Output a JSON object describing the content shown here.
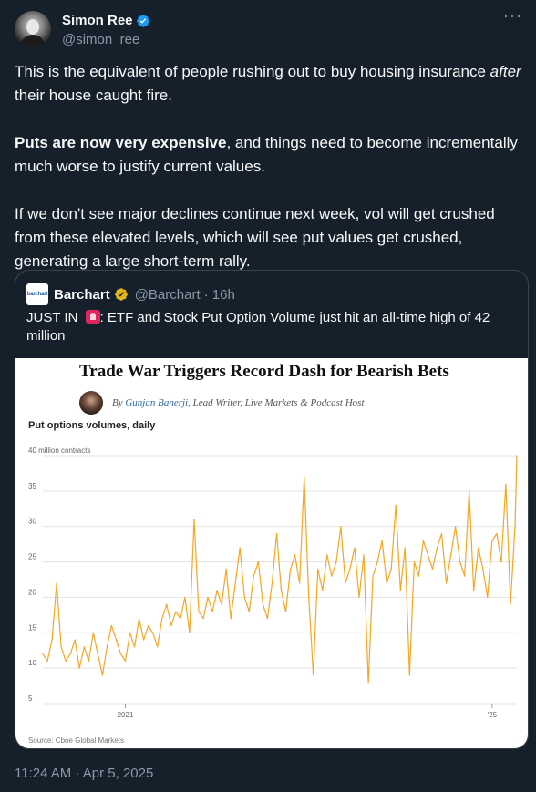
{
  "author": {
    "display_name": "Simon Ree",
    "handle": "@simon_ree",
    "verified": true
  },
  "tweet": {
    "p1_before": "This is the equivalent of people rushing out to buy housing insurance ",
    "p1_italic": "after",
    "p1_after": " their house caught fire.",
    "p2_bold": "Puts are now very expensive",
    "p2_rest": ", and things need to become incrementally much worse to justify current values.",
    "p3": "If we don't see major declines continue next week, vol will get crushed from these elevated levels, which will see put values get crushed, generating a large short-term rally."
  },
  "quote": {
    "logo_text": "barchart",
    "name": "Barchart",
    "handle": "@Barchart",
    "time": "· 16h",
    "text_before": "JUST IN ",
    "text_after": ": ETF and Stock Put Option Volume just hit an all-time high of 42 million",
    "article_title": "Trade War Triggers Record Dash for Bearish Bets",
    "byline_prefix": "By ",
    "byline_author": "Gunjan Banerji",
    "byline_suffix": ", Lead Writer, Live Markets & Podcast Host"
  },
  "chart_data": {
    "type": "line",
    "title": "Put options volumes, daily",
    "unit_label": "40 million contracts",
    "source": "Source: Cboe Global Markets",
    "x_tick_labels": [
      "2021",
      "'25"
    ],
    "y_ticks": [
      5,
      10,
      15,
      20,
      25,
      30,
      35,
      40
    ],
    "ylim": [
      5,
      40
    ],
    "xlim": [
      2020.1,
      2025.27
    ],
    "line_color": "#f5a623",
    "grid": true,
    "series": [
      {
        "x": [
          2020.1,
          2020.15,
          2020.2,
          2020.25,
          2020.3,
          2020.35,
          2020.4,
          2020.45,
          2020.5,
          2020.55,
          2020.6,
          2020.65,
          2020.7,
          2020.75,
          2020.8,
          2020.85,
          2020.9,
          2020.95,
          2021.0,
          2021.05,
          2021.1,
          2021.15,
          2021.2,
          2021.25,
          2021.3,
          2021.35,
          2021.4,
          2021.45,
          2021.5,
          2021.55,
          2021.6,
          2021.65,
          2021.7,
          2021.75,
          2021.8,
          2021.85,
          2021.9,
          2021.95,
          2022.0,
          2022.05,
          2022.1,
          2022.15,
          2022.2,
          2022.25,
          2022.3,
          2022.35,
          2022.4,
          2022.45,
          2022.5,
          2022.55,
          2022.6,
          2022.65,
          2022.7,
          2022.75,
          2022.8,
          2022.85,
          2022.9,
          2022.95,
          2023.0,
          2023.05,
          2023.1,
          2023.15,
          2023.2,
          2023.25,
          2023.3,
          2023.35,
          2023.4,
          2023.45,
          2023.5,
          2023.55,
          2023.6,
          2023.65,
          2023.7,
          2023.75,
          2023.8,
          2023.85,
          2023.9,
          2023.95,
          2024.0,
          2024.05,
          2024.1,
          2024.15,
          2024.2,
          2024.25,
          2024.3,
          2024.35,
          2024.4,
          2024.45,
          2024.5,
          2024.55,
          2024.6,
          2024.65,
          2024.7,
          2024.75,
          2024.8,
          2024.85,
          2024.9,
          2024.95,
          2025.0,
          2025.05,
          2025.1,
          2025.15,
          2025.2,
          2025.25,
          2025.27
        ],
        "y": [
          12,
          11,
          14,
          22,
          13,
          11,
          12,
          14,
          10,
          13,
          11,
          15,
          12,
          9,
          13,
          16,
          14,
          12,
          11,
          15,
          13,
          17,
          14,
          16,
          15,
          13,
          17,
          19,
          16,
          18,
          17,
          20,
          15,
          31,
          18,
          17,
          20,
          18,
          21,
          19,
          24,
          17,
          22,
          27,
          20,
          18,
          23,
          25,
          19,
          17,
          22,
          29,
          21,
          18,
          24,
          26,
          22,
          37,
          20,
          9,
          24,
          21,
          26,
          23,
          25,
          30,
          22,
          24,
          27,
          20,
          26,
          8,
          23,
          25,
          28,
          22,
          24,
          33,
          21,
          27,
          9,
          25,
          23,
          28,
          26,
          24,
          27,
          29,
          22,
          26,
          30,
          25,
          23,
          35,
          21,
          27,
          24,
          20,
          28,
          29,
          25,
          36,
          19,
          30,
          40
        ]
      }
    ]
  }
}
